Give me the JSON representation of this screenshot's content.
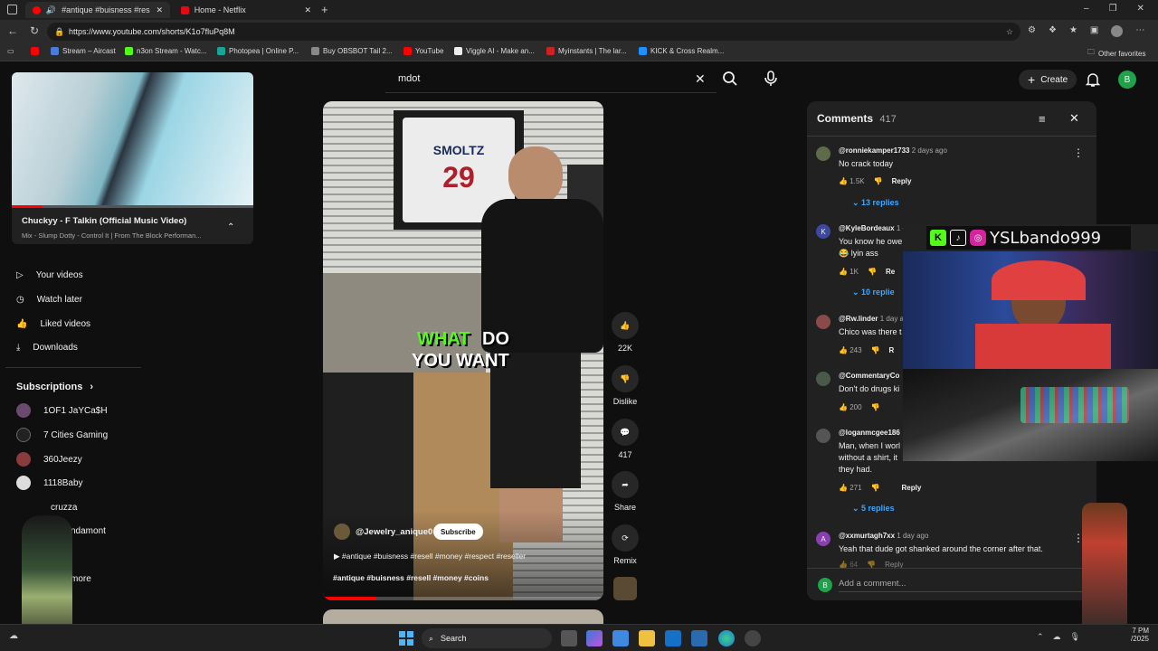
{
  "browser": {
    "tabs": [
      {
        "label": "#antique #buisness #resell",
        "active": true
      },
      {
        "label": "Home - Netflix",
        "active": false
      }
    ],
    "url": "https://www.youtube.com/shorts/K1o7fluPq8M",
    "bookmarks": [
      "Stream – Aircast",
      "n3on Stream - Watc...",
      "Photopea | Online P...",
      "Buy OBSBOT Tail 2...",
      "YouTube",
      "Viggle AI - Make an...",
      "Myinstants | The lar...",
      "KICK & Cross Realm..."
    ],
    "other_favorites": "Other favorites"
  },
  "youtube": {
    "search_value": "mdot",
    "create_label": "Create",
    "avatar_letter": "B",
    "miniplayer": {
      "title": "Chuckyy - F Talkin (Official Music Video)",
      "subtitle": "Mix - Slump Dotty - Control It | From The Block Performan..."
    },
    "sidebar": {
      "items": [
        "Your videos",
        "Watch later",
        "Liked videos",
        "Downloads"
      ],
      "subscriptions_label": "Subscriptions",
      "subscriptions": [
        "1OF1 JaYCa$H",
        "7 Cities Gaming",
        "360Jeezy",
        "1118Baby",
        "cruzza",
        "ndamont"
      ],
      "more_label": "more"
    },
    "short": {
      "caption_1": "WHAT",
      "caption_2": "DO",
      "caption_3": "YOU WANT",
      "jersey_name": "SMOLTZ",
      "jersey_number": "29",
      "channel": "@Jewelry_anique0",
      "subscribe_label": "Subscribe",
      "description": "#antique #buisness #resell #money #respect #reseller",
      "hashtags": "#antique #buisness #resell #money #coins",
      "progress_fraction": 0.19
    },
    "actions": {
      "like_count": "22K",
      "dislike_label": "Dislike",
      "comment_count": "417",
      "share_label": "Share",
      "remix_label": "Remix"
    },
    "comments": {
      "title": "Comments",
      "count": "417",
      "add_placeholder": "Add a comment...",
      "items": [
        {
          "user": "@ronniekamper1733",
          "time": "2 days ago",
          "text": "No crack today",
          "likes": "1.5K",
          "reply": "Reply",
          "replies": "13 replies"
        },
        {
          "user": "@KyleBordeaux",
          "time": "1 d",
          "text": "You know he owe",
          "text2": "😂 lyin ass",
          "likes": "1K",
          "reply": "Re",
          "replies": "10 replie"
        },
        {
          "user": "@Rw.linder",
          "time": "1 day a",
          "text": "Chico was there t",
          "likes": "243",
          "reply": "R"
        },
        {
          "user": "@CommentaryCo",
          "time": "",
          "text": "Don't do drugs ki",
          "likes": "200"
        },
        {
          "user": "@loganmcgee186",
          "time": "",
          "text": "Man, when I worl",
          "text2": "without a shirt, it",
          "text3": "they had.",
          "likes": "271",
          "reply": "Reply",
          "replies": "5 replies"
        },
        {
          "user": "@xxmurtagh7xx",
          "time": "1 day ago",
          "text": "Yeah that dude got shanked around the corner after that.",
          "likes": "64",
          "reply": "Reply"
        }
      ]
    }
  },
  "overlay": {
    "stream_name": "YSLbando999"
  },
  "taskbar": {
    "search_label": "Search",
    "time": "7 PM",
    "date": "/2025"
  },
  "colors": {
    "youtube_red": "#ff0000",
    "link_blue": "#3ea6ff",
    "kick_green": "#53fc18"
  }
}
